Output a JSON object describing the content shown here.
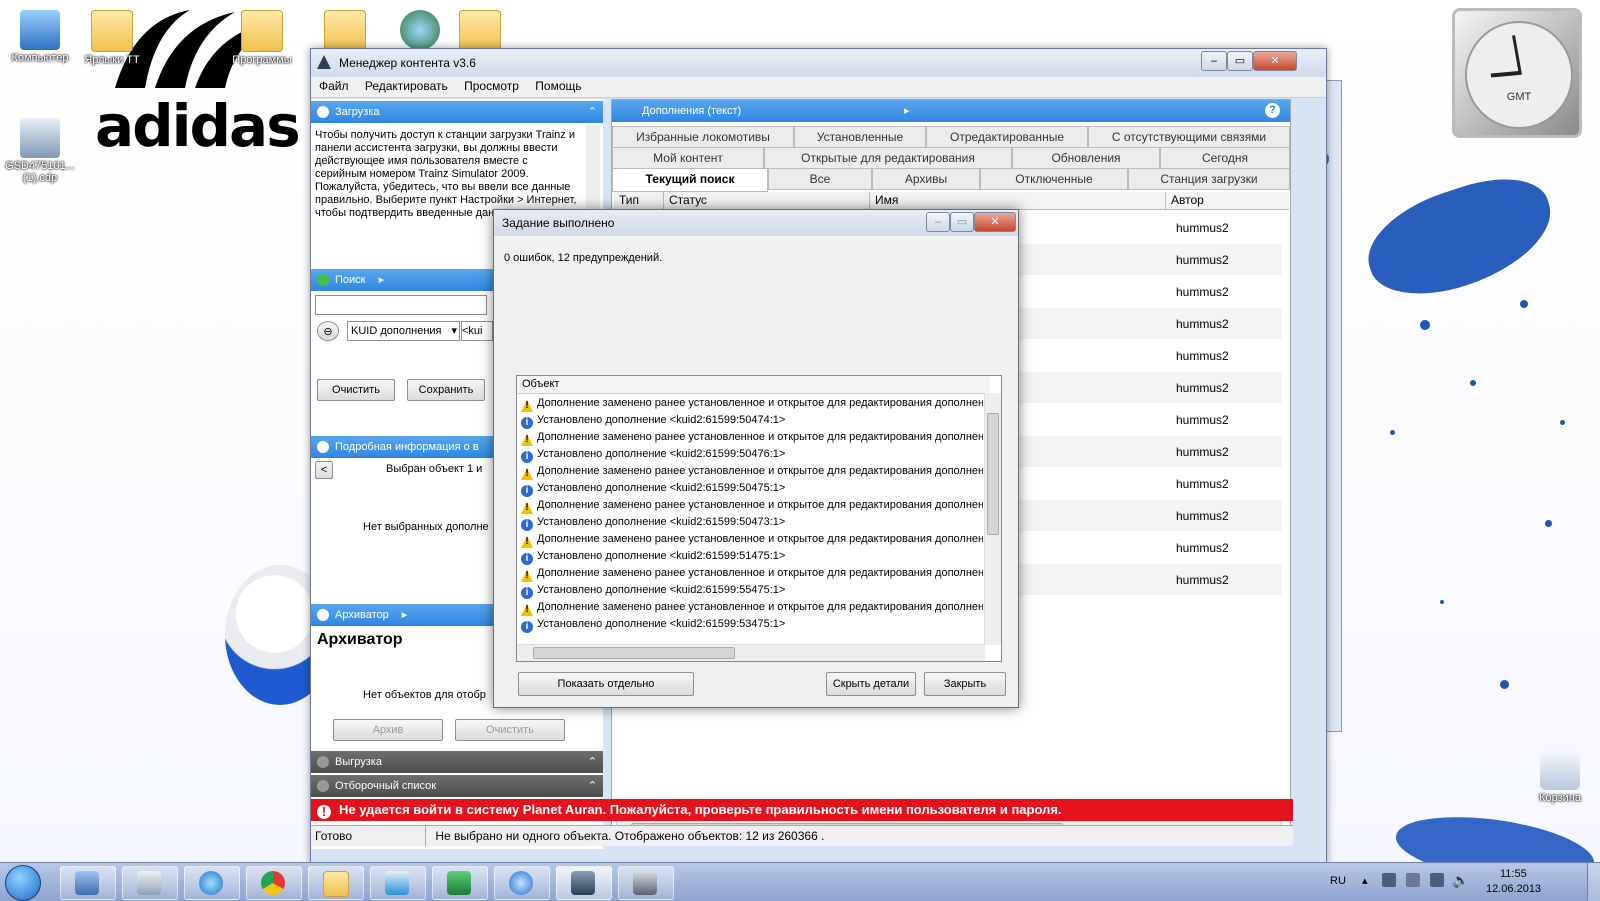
{
  "desktop": {
    "icons": [
      {
        "label": "Компьютер"
      },
      {
        "label": "Ярлыки ТТ"
      },
      {
        "label": "Программы"
      },
      {
        "label": "GSD475101... (1).cdp"
      },
      {
        "label": "Корзина"
      }
    ],
    "brand": "adidas",
    "clock_label": "GMT"
  },
  "window": {
    "title": "Менеджер контента v3.6",
    "menu": [
      "Файл",
      "Редактировать",
      "Просмотр",
      "Помощь"
    ],
    "left": {
      "download": {
        "header": "Загрузка",
        "text": "Чтобы получить доступ к станции загрузки Trainz и панели ассистента загрузки, вы должны ввести действующее имя пользователя вместе с серийным номером Trainz Simulator 2009. Пожалуйста, убедитесь, что вы ввели все данные правильно. Выберите пункт Настройки > Интернет, чтобы подтвердить введенные данные."
      },
      "search": {
        "header": "Поиск",
        "field": "KUID дополнения",
        "value_prefix": "<kui",
        "clear": "Очистить",
        "save": "Сохранить"
      },
      "details": {
        "header": "Подробная информация о в",
        "selected": "Выбран объект 1 и",
        "none": "Нет выбранных дополне"
      },
      "archiver": {
        "header": "Архиватор",
        "title": "Архиватор",
        "none": "Нет объектов для отобр",
        "archive": "Архив",
        "clear": "Очистить"
      },
      "upload": {
        "header": "Выгрузка"
      },
      "shortlist": {
        "header": "Отборочный список"
      }
    },
    "right": {
      "header": "Дополнения (текст)",
      "tabs_row1": [
        "Избранные локомотивы",
        "Установленные",
        "Отредактированные",
        "С отсутствующими связями"
      ],
      "tabs_row2": [
        "Мой контент",
        "Открытые для редактирования",
        "Обновления",
        "Сегодня"
      ],
      "tabs_row3": [
        "Текущий поиск",
        "Все",
        "Архивы",
        "Отключенные",
        "Станция загрузки"
      ],
      "columns": [
        "Тип",
        "Статус",
        "Имя",
        "Автор"
      ],
      "rows": [
        "hummus2",
        "hummus2",
        "hummus2",
        "hummus2",
        "hummus2",
        "hummus2",
        "hummus2",
        "hummus2",
        "hummus2",
        "hummus2",
        "hummus2",
        "hummus2"
      ]
    },
    "error_bar": "Не удается войти в систему Planet Auran. Пожалуйста, проверьте правильность имени пользователя и пароля.",
    "status": {
      "state": "Готово",
      "summary": "Не выбрано ни одного объекта. Отображено объектов: 12 из 260366 ."
    }
  },
  "dialog": {
    "title": "Задание выполнено",
    "message": "0 ошибок, 12 предупреждений.",
    "list_header": "Объект",
    "items": [
      {
        "type": "warning",
        "text": "Дополнение заменено ранее установленное и открытое для редактирования дополнен"
      },
      {
        "type": "info",
        "text": "Установлено дополнение <kuid2:61599:50474:1>"
      },
      {
        "type": "warning",
        "text": "Дополнение заменено ранее установленное и открытое для редактирования дополнен"
      },
      {
        "type": "info",
        "text": "Установлено дополнение <kuid2:61599:50476:1>"
      },
      {
        "type": "warning",
        "text": "Дополнение заменено ранее установленное и открытое для редактирования дополнен"
      },
      {
        "type": "info",
        "text": "Установлено дополнение <kuid2:61599:50475:1>"
      },
      {
        "type": "warning",
        "text": "Дополнение заменено ранее установленное и открытое для редактирования дополнен"
      },
      {
        "type": "info",
        "text": "Установлено дополнение <kuid2:61599:50473:1>"
      },
      {
        "type": "warning",
        "text": "Дополнение заменено ранее установленное и открытое для редактирования дополнен"
      },
      {
        "type": "info",
        "text": "Установлено дополнение <kuid2:61599:51475:1>"
      },
      {
        "type": "warning",
        "text": "Дополнение заменено ранее установленное и открытое для редактирования дополнен"
      },
      {
        "type": "info",
        "text": "Установлено дополнение <kuid2:61599:55475:1>"
      },
      {
        "type": "warning",
        "text": "Дополнение заменено ранее установленное и открытое для редактирования дополнен"
      },
      {
        "type": "info",
        "text": "Установлено дополнение <kuid2:61599:53475:1>"
      }
    ],
    "buttons": {
      "show_separately": "Показать отдельно",
      "hide_details": "Скрыть детали",
      "close": "Закрыть"
    }
  },
  "taskbar": {
    "lang": "RU",
    "time": "11:55",
    "date": "12.06.2013"
  },
  "colors": {
    "accent": "#2f86e0",
    "error": "#e3121c",
    "taskbar": "#a3b6db"
  }
}
